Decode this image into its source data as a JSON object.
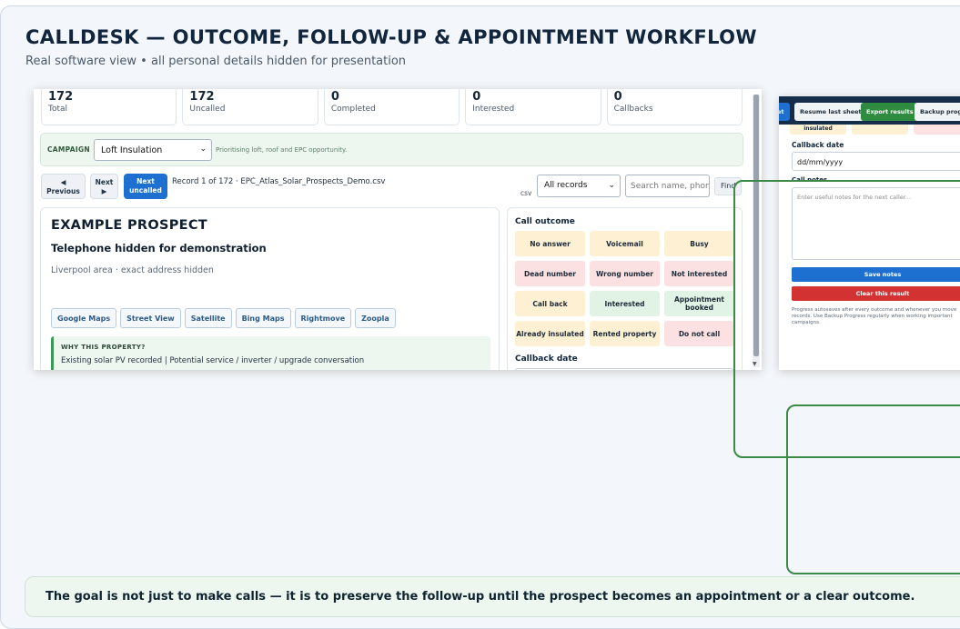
{
  "header": {
    "title": "CALLDESK — OUTCOME, FOLLOW-UP & APPOINTMENT WORKFLOW",
    "subtitle": "Real software view • all personal details hidden for presentation"
  },
  "stats": [
    {
      "num": "172",
      "label": "Total"
    },
    {
      "num": "172",
      "label": "Uncalled"
    },
    {
      "num": "0",
      "label": "Completed"
    },
    {
      "num": "0",
      "label": "Interested"
    },
    {
      "num": "0",
      "label": "Callbacks"
    }
  ],
  "campaign": {
    "label": "CAMPAIGN",
    "selected": "Loft Insulation",
    "hint": "Prioritising loft, roof and EPC opportunity."
  },
  "navigation": {
    "prev_arrow": "◀",
    "prev_label": "Previous",
    "next_label": "Next",
    "next_arrow": "▶",
    "uncalled_line1": "Next",
    "uncalled_line2": "uncalled",
    "record_text": "Record 1 of 172 · EPC_Atlas_Solar_Prospects_Demo.csv",
    "csv_label": "csv",
    "filter_selected": "All records",
    "search_placeholder": "Search name, phon",
    "find_label": "Find"
  },
  "prospect": {
    "name": "EXAMPLE PROSPECT",
    "phone": "Telephone hidden for demonstration",
    "area": "Liverpool area · exact address hidden",
    "map_links": [
      "Google Maps",
      "Street View",
      "Satellite",
      "Bing Maps",
      "Rightmove",
      "Zoopla"
    ],
    "why_title": "WHY THIS PROPERTY?",
    "why_text": "Existing solar PV recorded | Potential service / inverter / upgrade conversation"
  },
  "outcome": {
    "title": "Call outcome",
    "buttons": [
      {
        "label": "No answer",
        "tone": "amber"
      },
      {
        "label": "Voicemail",
        "tone": "amber"
      },
      {
        "label": "Busy",
        "tone": "amber"
      },
      {
        "label": "Dead number",
        "tone": "red"
      },
      {
        "label": "Wrong number",
        "tone": "red"
      },
      {
        "label": "Not interested",
        "tone": "red"
      },
      {
        "label": "Call back",
        "tone": "amber"
      },
      {
        "label": "Interested",
        "tone": "green"
      },
      {
        "label": "Appointment booked",
        "tone": "green"
      },
      {
        "label": "Already insulated",
        "tone": "amber"
      },
      {
        "label": "Rented property",
        "tone": "amber"
      },
      {
        "label": "Do not call",
        "tone": "red"
      }
    ],
    "callback_label": "Callback date"
  },
  "right_panel": {
    "set_label": "et",
    "resume_label": "Resume last sheet",
    "export_label": "Export results",
    "backup_label": "Backup progre",
    "top_tag": "insulated",
    "callback_label": "Callback date",
    "date_placeholder": "dd/mm/yyyy",
    "notes_label": "Call notes",
    "notes_placeholder": "Enter useful notes for the next caller...",
    "save_label": "Save notes",
    "clear_label": "Clear this result",
    "help_text": "Progress autosaves after every outcome and whenever you move records. Use Backup Progress regularly when working important campaigns."
  },
  "footer": {
    "message": "The goal is not just to make calls — it is to preserve the follow-up until the prospect becomes an appointment or a clear outcome."
  },
  "colors": {
    "accent": "#1d6fd0",
    "export_green": "#2e8b3f",
    "clear_red": "#d23232",
    "highlight": "#3b8a45"
  }
}
